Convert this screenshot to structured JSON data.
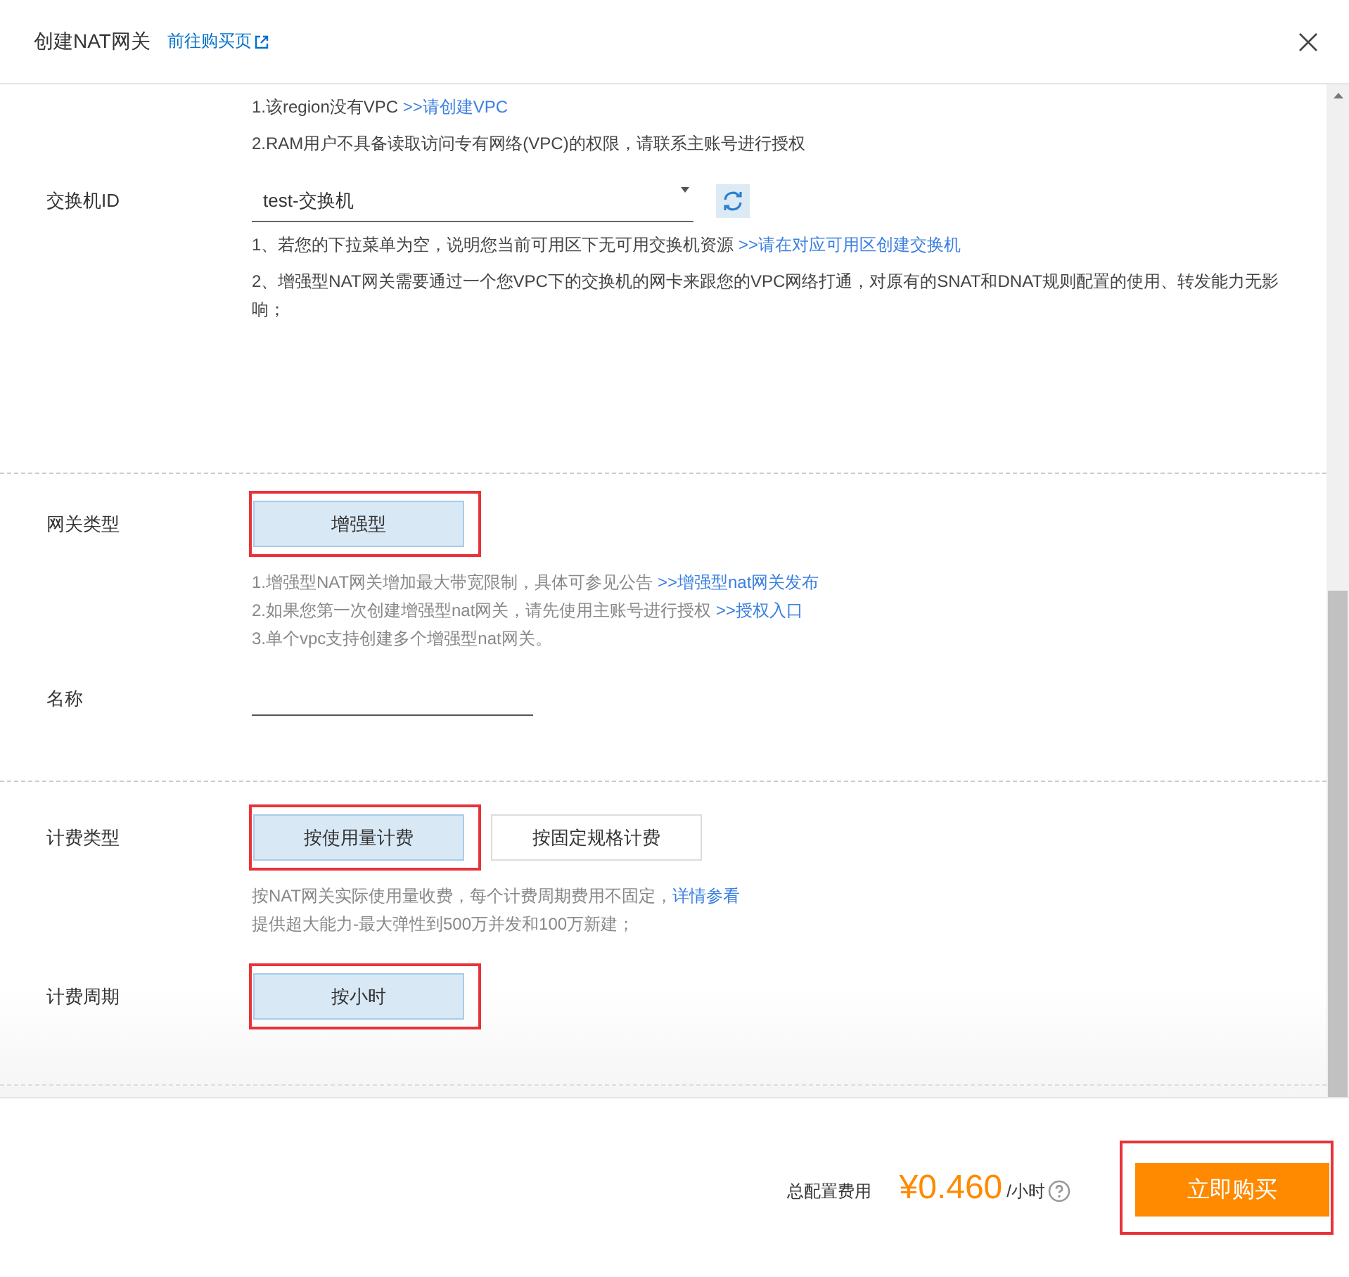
{
  "dialog": {
    "title": "创建NAT网关",
    "link": "前往购买页"
  },
  "sections": [
    {
      "rows": [
        {
          "kind": "notes",
          "lines": [
            {
              "text": "1.该region没有VPC ",
              "link": ">>请创建VPC"
            },
            {
              "text": "2.RAM用户不具备读取访问专有网络(VPC)的权限，请联系主账号进行授权"
            }
          ]
        },
        {
          "kind": "select",
          "label": "交换机ID",
          "value": "test-交换机"
        },
        {
          "kind": "notes",
          "lines": [
            {
              "text": "1、若您的下拉菜单为空，说明您当前可用区下无可用交换机资源 ",
              "link": ">>请在对应可用区创建交换机"
            },
            {
              "text": "2、增强型NAT网关需要通过一个您VPC下的交换机的网卡来跟您的VPC网络打通，对原有的SNAT和DNAT规则配置的使用、转发能力无影响；"
            }
          ]
        }
      ]
    },
    {
      "rows": [
        {
          "kind": "options",
          "label": "网关类型",
          "options": [
            {
              "label": "增强型",
              "selected": true,
              "highlighted": true
            }
          ]
        },
        {
          "kind": "hints",
          "lines": [
            {
              "text": "1.增强型NAT网关增加最大带宽限制，具体可参见公告 ",
              "link": ">>增强型nat网关发布"
            },
            {
              "text": "2.如果您第一次创建增强型nat网关，请先使用主账号进行授权 ",
              "link": ">>授权入口"
            },
            {
              "text": "3.单个vpc支持创建多个增强型nat网关。"
            }
          ]
        },
        {
          "kind": "text_input",
          "label": "名称"
        }
      ]
    },
    {
      "rows": [
        {
          "kind": "options",
          "label": "计费类型",
          "options": [
            {
              "label": "按使用量计费",
              "selected": true,
              "highlighted": true
            },
            {
              "label": "按固定规格计费",
              "selected": false,
              "highlighted": false
            }
          ]
        },
        {
          "kind": "hints",
          "lines": [
            {
              "text": "按NAT网关实际使用量收费，每个计费周期费用不固定，",
              "link": "详情参看"
            },
            {
              "text": "提供超大能力-最大弹性到500万并发和100万新建；"
            }
          ]
        },
        {
          "kind": "options",
          "label": "计费周期",
          "options": [
            {
              "label": "按小时",
              "selected": true,
              "highlighted": true
            }
          ]
        }
      ]
    }
  ],
  "footer": {
    "cost_label": "总配置费用",
    "price": "¥0.460",
    "unit": "/小时",
    "buy_button": "立即购买",
    "buy_highlighted": true
  }
}
